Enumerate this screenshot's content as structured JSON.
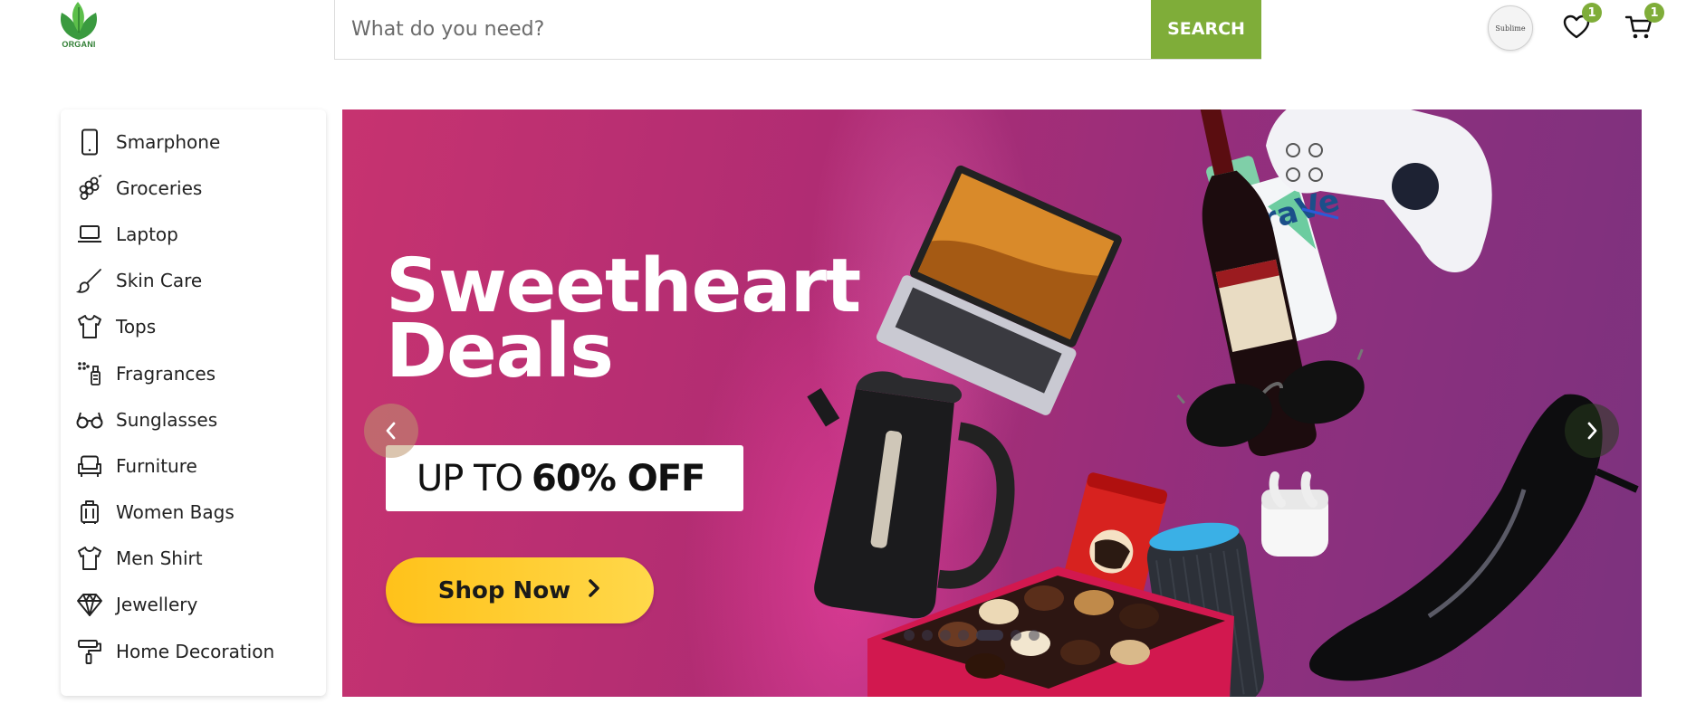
{
  "header": {
    "logo_text": "ORGANI",
    "search_placeholder": "What do you need?",
    "search_button": "SEARCH",
    "avatar_text": "Sublime",
    "wishlist_count": "1",
    "cart_count": "1",
    "accent_color": "#7fad39"
  },
  "sidebar": {
    "categories": [
      {
        "label": "Smarphone",
        "icon": "smartphone-icon"
      },
      {
        "label": "Groceries",
        "icon": "grapes-icon"
      },
      {
        "label": "Laptop",
        "icon": "laptop-icon"
      },
      {
        "label": "Skin Care",
        "icon": "brush-icon"
      },
      {
        "label": "Tops",
        "icon": "shirt-icon"
      },
      {
        "label": "Fragrances",
        "icon": "spray-bottle-icon"
      },
      {
        "label": "Sunglasses",
        "icon": "glasses-icon"
      },
      {
        "label": "Furniture",
        "icon": "sofa-icon"
      },
      {
        "label": "Women Bags",
        "icon": "luggage-icon"
      },
      {
        "label": "Men Shirt",
        "icon": "shirt-icon"
      },
      {
        "label": "Jewellery",
        "icon": "diamond-icon"
      },
      {
        "label": "Home Decoration",
        "icon": "paint-roller-icon"
      }
    ]
  },
  "banner": {
    "title_line1": "Sweetheart",
    "title_line2": "Deals",
    "offer_prefix": "UP TO",
    "offer_strong": "60% OFF",
    "cta_label": "Shop Now",
    "slide_count": 7,
    "active_slide": 4
  }
}
